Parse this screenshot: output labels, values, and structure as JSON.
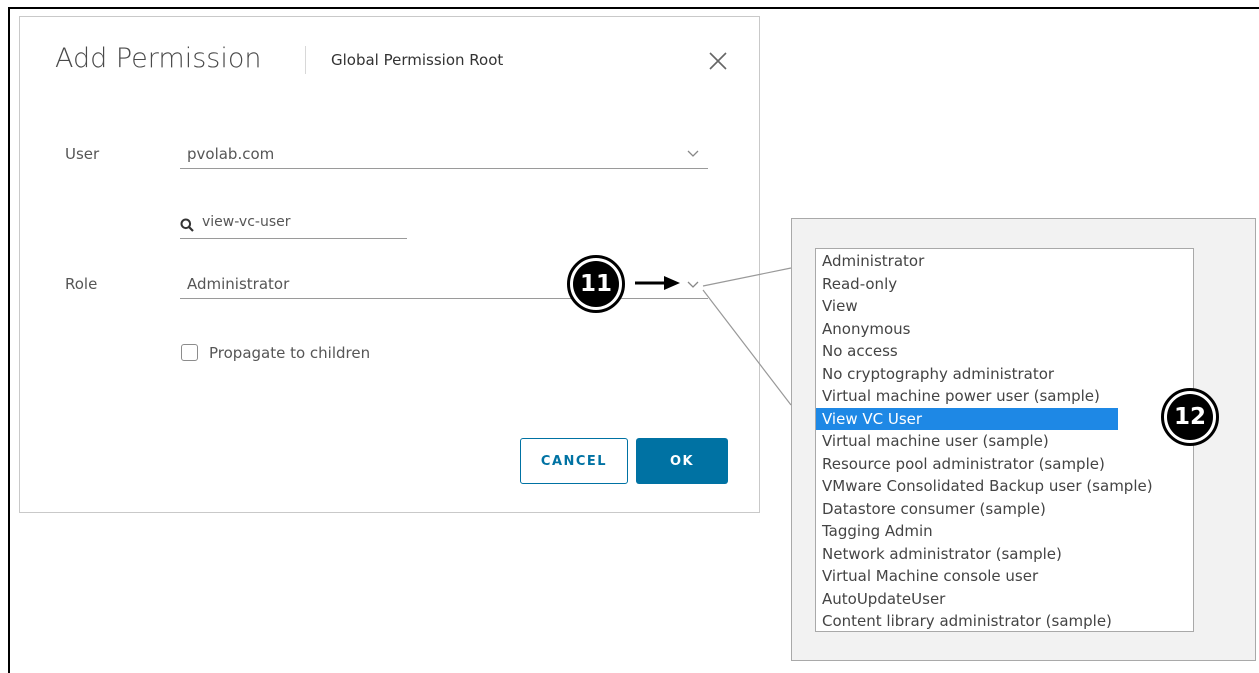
{
  "dialog": {
    "title": "Add Permission",
    "subtitle": "Global Permission Root",
    "close_icon": "close-icon",
    "user_label": "User",
    "user_value": "pvolab.com",
    "search_value": "view-vc-user",
    "role_label": "Role",
    "role_value": "Administrator",
    "propagate_label": "Propagate to children",
    "propagate_checked": false,
    "cancel_label": "CANCEL",
    "ok_label": "OK"
  },
  "callouts": {
    "first": "11",
    "second": "12"
  },
  "role_options": [
    "Administrator",
    "Read-only",
    "View",
    "Anonymous",
    "No access",
    "No cryptography administrator",
    "Virtual machine power user (sample)",
    "View VC User",
    "Virtual machine user (sample)",
    "Resource pool administrator (sample)",
    "VMware Consolidated Backup user (sample)",
    "Datastore consumer (sample)",
    "Tagging Admin",
    "Network administrator (sample)",
    "Virtual Machine console user",
    "AutoUpdateUser",
    "Content library administrator (sample)"
  ],
  "selected_role": "View VC User",
  "colors": {
    "accent": "#0072a3",
    "selection": "#1e88e5"
  }
}
